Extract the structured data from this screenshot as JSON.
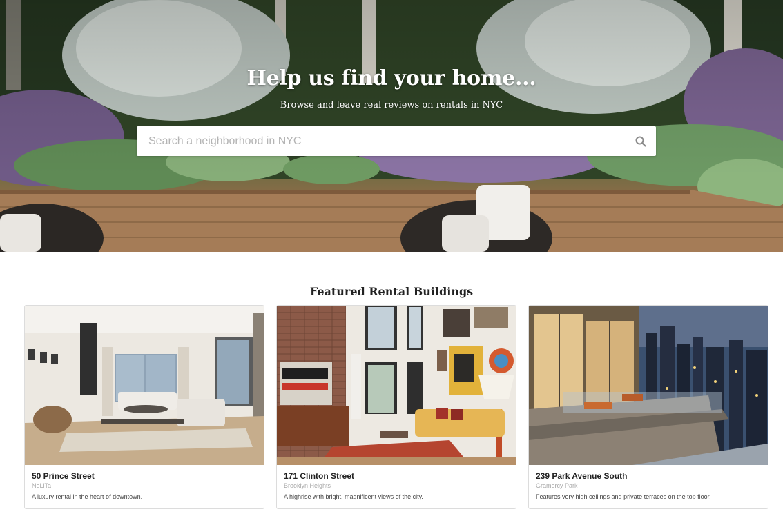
{
  "hero": {
    "title": "Help us find your home...",
    "subtitle": "Browse and leave real reviews on rentals in NYC",
    "search": {
      "placeholder": "Search a neighborhood in NYC",
      "value": "",
      "icon": "search-icon"
    }
  },
  "featured": {
    "title": "Featured Rental Buildings",
    "buildings": [
      {
        "name": "50 Prince Street",
        "neighborhood": "NoLiTa",
        "description": "A luxury rental in the heart of downtown."
      },
      {
        "name": "171 Clinton Street",
        "neighborhood": "Brooklyn Heights",
        "description": "A highrise with bright, magnificent views of the city."
      },
      {
        "name": "239 Park Avenue South",
        "neighborhood": "Gramercy Park",
        "description": "Features very high ceilings and private terraces on the top floor."
      }
    ]
  },
  "colors": {
    "page_background": "#ffffff",
    "hero_text": "#ffffff",
    "placeholder_text": "#b4b4b4",
    "card_border": "#dcdcdc",
    "muted_text": "#a8a8a8"
  }
}
